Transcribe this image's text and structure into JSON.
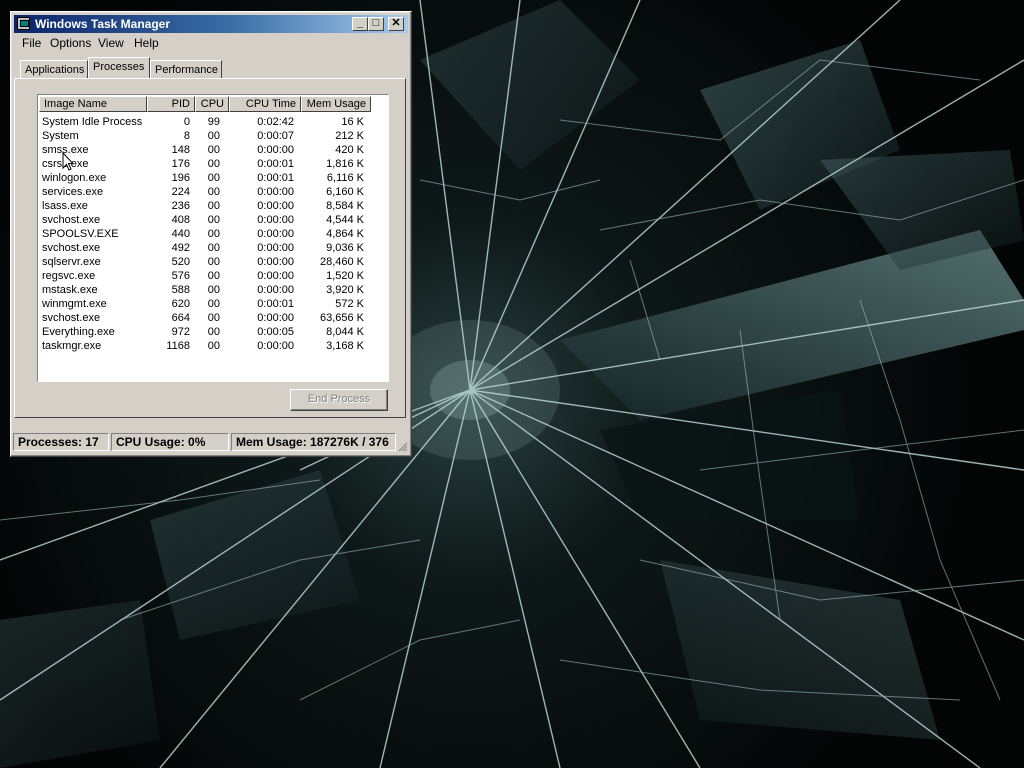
{
  "window": {
    "title": "Windows Task Manager",
    "buttons": {
      "minimize": "_",
      "maximize": "□",
      "close": "✕"
    }
  },
  "menu": [
    "File",
    "Options",
    "View",
    "Help"
  ],
  "tabs": [
    "Applications",
    "Processes",
    "Performance"
  ],
  "active_tab": "Processes",
  "columns": [
    "Image Name",
    "PID",
    "CPU",
    "CPU Time",
    "Mem Usage"
  ],
  "processes": [
    [
      "System Idle Process",
      "0",
      "99",
      "0:02:42",
      "16 K"
    ],
    [
      "System",
      "8",
      "00",
      "0:00:07",
      "212 K"
    ],
    [
      "smss.exe",
      "148",
      "00",
      "0:00:00",
      "420 K"
    ],
    [
      "csrss.exe",
      "176",
      "00",
      "0:00:01",
      "1,816 K"
    ],
    [
      "winlogon.exe",
      "196",
      "00",
      "0:00:01",
      "6,116 K"
    ],
    [
      "services.exe",
      "224",
      "00",
      "0:00:00",
      "6,160 K"
    ],
    [
      "lsass.exe",
      "236",
      "00",
      "0:00:00",
      "8,584 K"
    ],
    [
      "svchost.exe",
      "408",
      "00",
      "0:00:00",
      "4,544 K"
    ],
    [
      "SPOOLSV.EXE",
      "440",
      "00",
      "0:00:00",
      "4,864 K"
    ],
    [
      "svchost.exe",
      "492",
      "00",
      "0:00:00",
      "9,036 K"
    ],
    [
      "sqlservr.exe",
      "520",
      "00",
      "0:00:00",
      "28,460 K"
    ],
    [
      "regsvc.exe",
      "576",
      "00",
      "0:00:00",
      "1,520 K"
    ],
    [
      "mstask.exe",
      "588",
      "00",
      "0:00:00",
      "3,920 K"
    ],
    [
      "winmgmt.exe",
      "620",
      "00",
      "0:00:01",
      "572 K"
    ],
    [
      "svchost.exe",
      "664",
      "00",
      "0:00:00",
      "63,656 K"
    ],
    [
      "Everything.exe",
      "972",
      "00",
      "0:00:05",
      "8,044 K"
    ],
    [
      "taskmgr.exe",
      "1168",
      "00",
      "0:00:00",
      "3,168 K"
    ]
  ],
  "end_process_label": "End Process",
  "status": {
    "processes": "Processes: 17",
    "cpu": "CPU Usage: 0%",
    "mem": "Mem Usage: 187276K / 376"
  },
  "icons": [
    "task-manager-icon",
    "mouse-cursor-icon",
    "resize-grip-icon"
  ]
}
